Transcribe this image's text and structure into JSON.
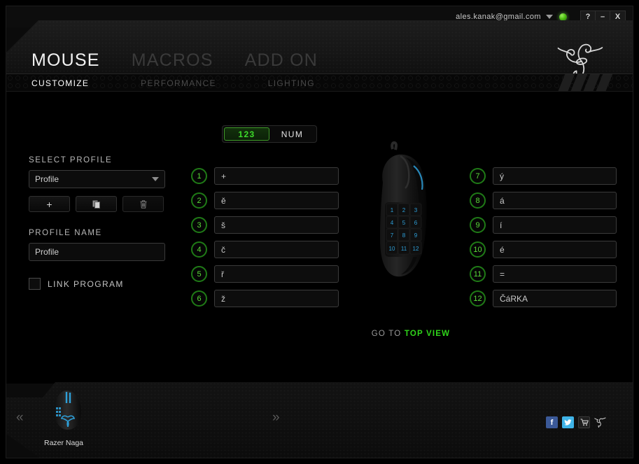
{
  "titlebar": {
    "account": "ales.kanak@gmail.com",
    "dropdown_icon": "chevron-down-icon",
    "status_icon": "online-status-led",
    "buttons": [
      {
        "label": "?",
        "name": "help-button"
      },
      {
        "label": "–",
        "name": "minimize-button"
      },
      {
        "label": "X",
        "name": "close-button"
      }
    ]
  },
  "header": {
    "main_tabs": [
      {
        "label": "MOUSE",
        "active": true
      },
      {
        "label": "MACROS",
        "active": false
      },
      {
        "label": "ADD ON",
        "active": false
      }
    ],
    "logo_icon": "razer-logo"
  },
  "subtabs": [
    {
      "label": "CUSTOMIZE",
      "active": true
    },
    {
      "label": "PERFORMANCE",
      "active": false
    },
    {
      "label": "LIGHTING",
      "active": false
    }
  ],
  "profile": {
    "select_label": "SELECT PROFILE",
    "selected": "Profile",
    "buttons": [
      {
        "name": "add-profile-button",
        "icon": "plus-icon"
      },
      {
        "name": "duplicate-profile-button",
        "icon": "copy-icon"
      },
      {
        "name": "delete-profile-button",
        "icon": "trash-icon"
      }
    ],
    "name_label": "PROFILE NAME",
    "name_value": "Profile",
    "link_program_label": "LINK PROGRAM",
    "link_program_checked": false
  },
  "mode_toggle": {
    "options": [
      {
        "label": "123",
        "active": true
      },
      {
        "label": "NUM",
        "active": false
      }
    ]
  },
  "keys_left": [
    {
      "num": "1",
      "value": "+"
    },
    {
      "num": "2",
      "value": "ě"
    },
    {
      "num": "3",
      "value": "š"
    },
    {
      "num": "4",
      "value": "č"
    },
    {
      "num": "5",
      "value": "ř"
    },
    {
      "num": "6",
      "value": "ž"
    }
  ],
  "keys_right": [
    {
      "num": "7",
      "value": "ý"
    },
    {
      "num": "8",
      "value": "á"
    },
    {
      "num": "9",
      "value": "í"
    },
    {
      "num": "10",
      "value": "é"
    },
    {
      "num": "11",
      "value": "="
    },
    {
      "num": "12",
      "value": "ČáRKA"
    }
  ],
  "mouse_view": {
    "button_numbers": [
      "1",
      "2",
      "3",
      "4",
      "5",
      "6",
      "7",
      "8",
      "9",
      "10",
      "11",
      "12"
    ],
    "goto_prefix": "GO TO",
    "goto_link": "TOP VIEW"
  },
  "footer": {
    "prev_icon": "«",
    "next_icon": "»",
    "device_name": "Razer Naga",
    "social": [
      {
        "name": "facebook-icon",
        "glyph": "f",
        "color": "#3b5998"
      },
      {
        "name": "twitter-icon",
        "glyph": "ᵗ",
        "color": "#3fb4e8"
      },
      {
        "name": "cart-icon",
        "glyph": "Ὥ2",
        "color": "#1e1e1e"
      },
      {
        "name": "razer-icon",
        "glyph": "",
        "color": "transparent"
      }
    ]
  },
  "colors": {
    "accent_green": "#3ddc2a",
    "badge_green": "#5bdc3a",
    "blue_led": "#2e9fd8"
  }
}
